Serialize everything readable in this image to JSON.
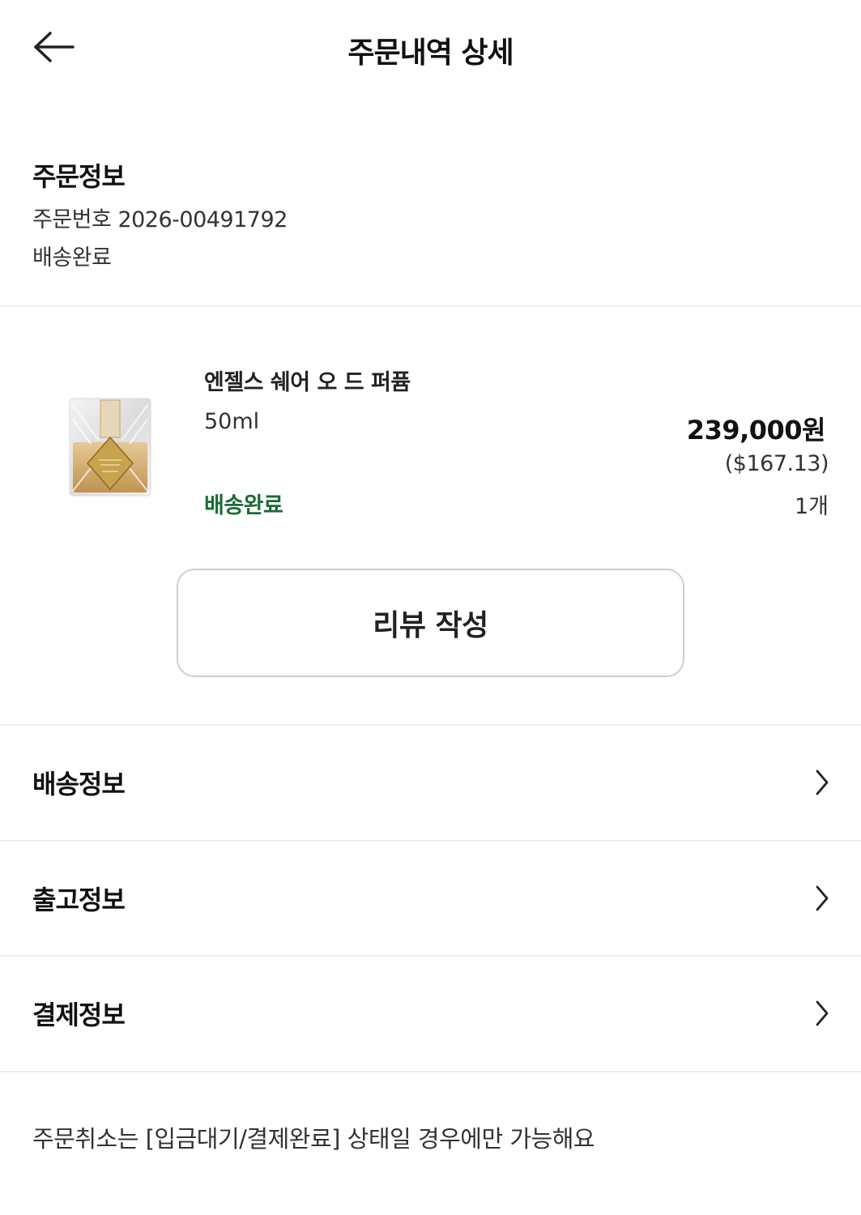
{
  "header": {
    "title": "주문내역 상세",
    "back_icon": "arrow-left-icon"
  },
  "order_info": {
    "title": "주문정보",
    "order_number": "주문번호 2026-00491792",
    "status": "배송완료"
  },
  "product": {
    "name": "엔젤스 쉐어 오 드 퍼퓸",
    "option": "50ml",
    "status": "배송완료",
    "status_color": "#1b6b34",
    "price_krw": "239,000원",
    "price_usd": "($167.13)",
    "quantity": "1개",
    "image_label": "perfume-bottle-image"
  },
  "review_button": {
    "label": "리뷰 작성"
  },
  "menu": [
    {
      "label": "배송정보",
      "icon": "chevron-right-icon"
    },
    {
      "label": "출고정보",
      "icon": "chevron-right-icon"
    },
    {
      "label": "결제정보",
      "icon": "chevron-right-icon"
    }
  ],
  "notice": "주문취소는 [입금대기/결제완료] 상태일 경우에만 가능해요",
  "colors": {
    "divider": "#ececec",
    "button_border": "#cfcfcf",
    "accent_green": "#1b6b34"
  }
}
